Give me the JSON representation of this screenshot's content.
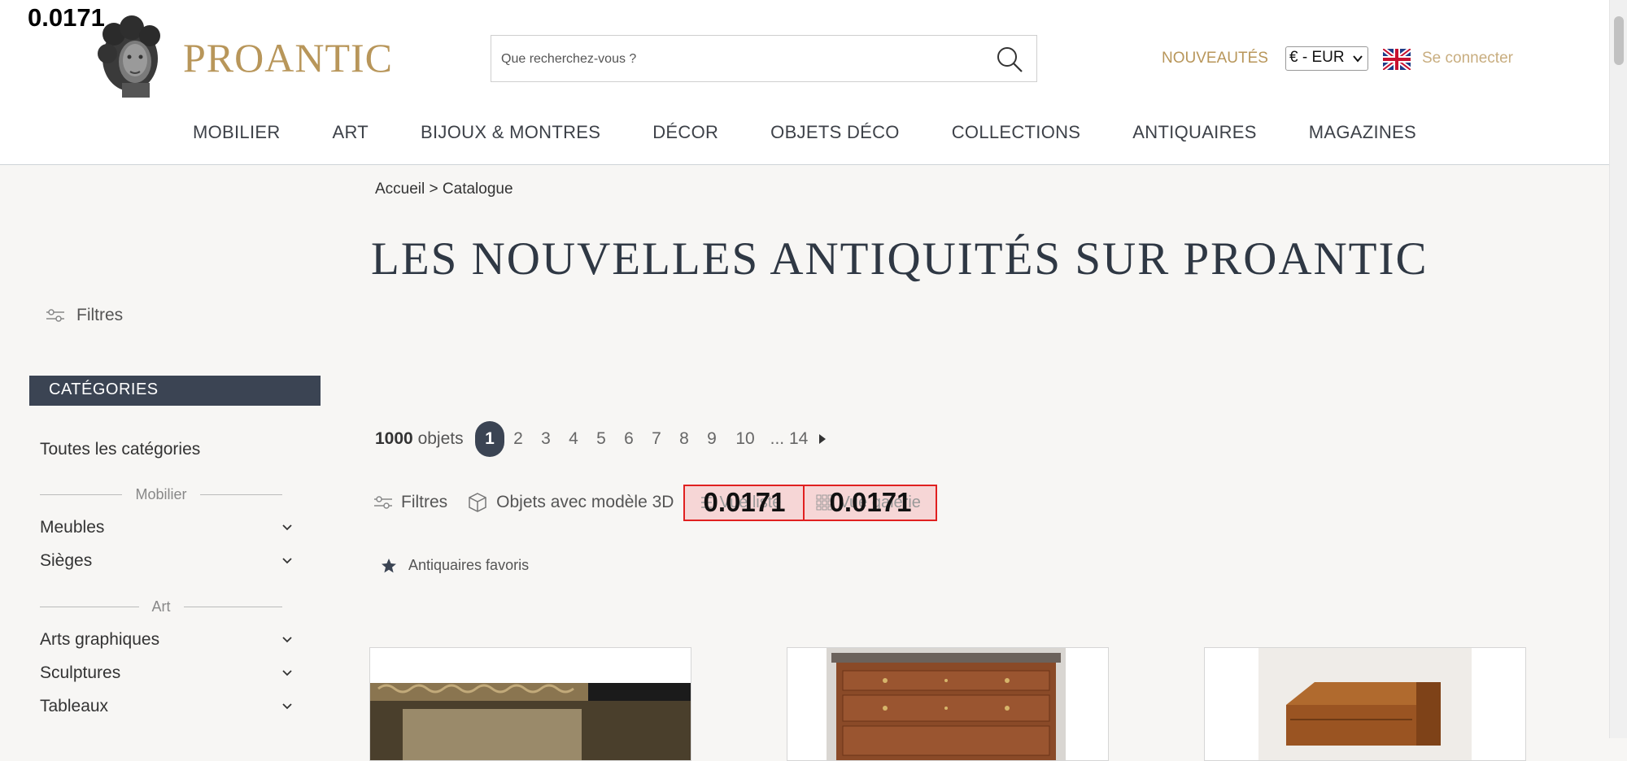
{
  "overlay": {
    "value": "0.0171"
  },
  "header": {
    "logo_text": "PROANTIC",
    "search_placeholder": "Que recherchez-vous ?",
    "nouveautes": "NOUVEAUTÉS",
    "currency": "€ - EUR",
    "connect": "Se connecter"
  },
  "nav": [
    {
      "label": "MOBILIER"
    },
    {
      "label": "ART"
    },
    {
      "label": "BIJOUX & MONTRES"
    },
    {
      "label": "DÉCOR"
    },
    {
      "label": "OBJETS DÉCO"
    },
    {
      "label": "COLLECTIONS"
    },
    {
      "label": "ANTIQUAIRES"
    },
    {
      "label": "MAGAZINES"
    }
  ],
  "breadcrumb": "Accueil > Catalogue",
  "page_title": "LES NOUVELLES ANTIQUITÉS SUR PROANTIC",
  "sidebar": {
    "filters": "Filtres",
    "categories_header": "CATÉGORIES",
    "all_categories": "Toutes les catégories",
    "sections": [
      {
        "title": "Mobilier",
        "items": [
          "Meubles",
          "Sièges"
        ]
      },
      {
        "title": "Art",
        "items": [
          "Arts graphiques",
          "Sculptures",
          "Tableaux"
        ]
      }
    ]
  },
  "results": {
    "count_number": "1000",
    "count_label": "objets",
    "pages": [
      "1",
      "2",
      "3",
      "4",
      "5",
      "6",
      "7",
      "8",
      "9",
      "10",
      "... 14"
    ],
    "current_page": "1"
  },
  "toolbar": {
    "filters": "Filtres",
    "model3d": "Objets avec modèle 3D",
    "view_list": "Vue liste",
    "view_gallery": "Vue galerie",
    "highlight_value": "0.0171"
  },
  "favorites": "Antiquaires favoris",
  "colors": {
    "gold": "#b8965a",
    "dark_slate": "#3b4453",
    "highlight": "#e02020"
  }
}
